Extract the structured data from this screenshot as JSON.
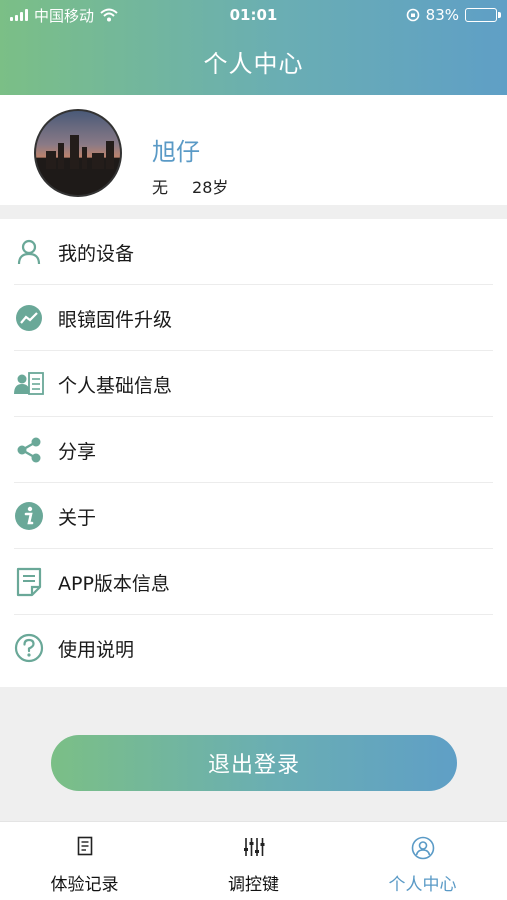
{
  "status_bar": {
    "carrier": "中国移动",
    "time": "01:01",
    "battery": "83%",
    "battery_level": 0.83
  },
  "header": {
    "title": "个人中心"
  },
  "profile": {
    "name": "旭仔",
    "gender": "无",
    "age": "28岁"
  },
  "menu": {
    "items": [
      {
        "label": "我的设备",
        "icon": "person-icon"
      },
      {
        "label": "眼镜固件升级",
        "icon": "trend-icon"
      },
      {
        "label": "个人基础信息",
        "icon": "id-card-icon"
      },
      {
        "label": "分享",
        "icon": "share-icon"
      },
      {
        "label": "关于",
        "icon": "info-icon"
      },
      {
        "label": "APP版本信息",
        "icon": "document-icon"
      },
      {
        "label": "使用说明",
        "icon": "help-icon"
      }
    ]
  },
  "logout": {
    "label": "退出登录"
  },
  "tabbar": {
    "tabs": [
      {
        "label": "体验记录",
        "icon": "note-icon"
      },
      {
        "label": "调控键",
        "icon": "sliders-icon"
      },
      {
        "label": "个人中心",
        "icon": "user-circle-icon"
      }
    ],
    "active_index": 2
  },
  "colors": {
    "accent": "#5a9ac6",
    "icon_green": "#6aa898",
    "gradient_start": "#7bbf86",
    "gradient_end": "#5f9fc6"
  }
}
